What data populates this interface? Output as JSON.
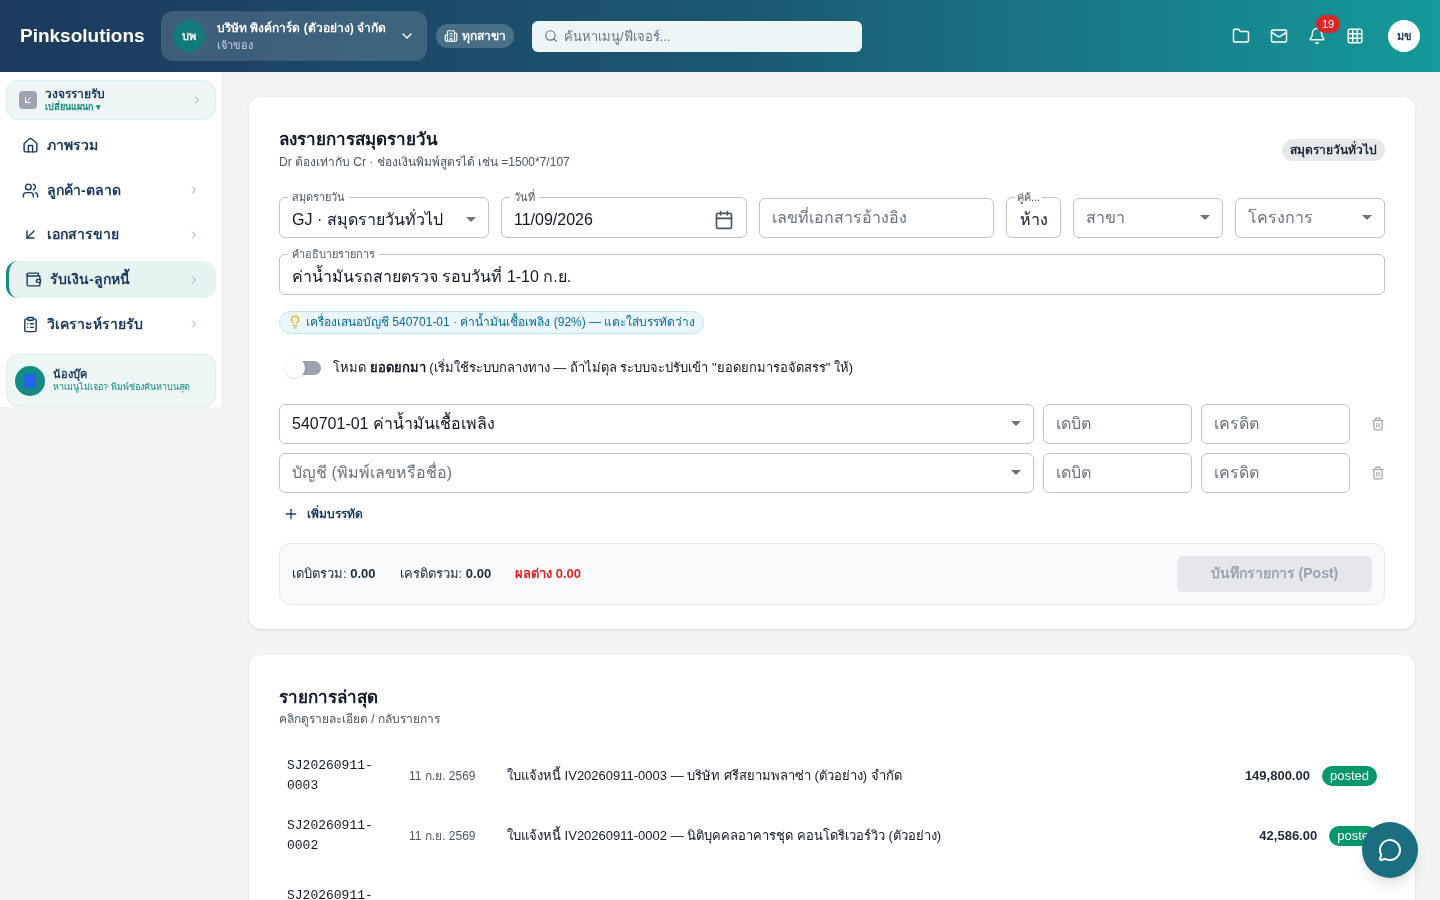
{
  "header": {
    "brand": "Pinksolutions",
    "org": {
      "initials": "บพ",
      "name": "บริษัท พิงค์การ์ด (ตัวอย่าง) จำกัด",
      "role": "เจ้าของ"
    },
    "branch": "ทุกสาขา",
    "search_placeholder": "ค้นหาเมนู/ฟีเจอร์...",
    "notifications": "19",
    "user_initials": "มข"
  },
  "sidebar": {
    "module": {
      "title": "วงจรรายรับ",
      "switch": "เปลี่ยนแผนก ▾"
    },
    "items": [
      {
        "label": "ภาพรวม",
        "kind": "link",
        "selected": false
      },
      {
        "label": "ลูกค้า-ตลาด",
        "kind": "group",
        "selected": false
      },
      {
        "label": "เอกสารขาย",
        "kind": "group",
        "selected": false
      },
      {
        "label": "รับเงิน-ลูกหนี้",
        "kind": "group",
        "selected": true
      },
      {
        "label": "วิเคราะห์รายรับ",
        "kind": "group",
        "selected": false
      }
    ],
    "assistant": {
      "name": "น้องบุ๊ค",
      "hint": "หาเมนูไม่เจอ? พิมพ์ช่องค้นหาบนสุด"
    }
  },
  "entry_form": {
    "title": "ลงรายการสมุดรายวัน",
    "subtitle": "Dr ต้องเท่ากับ Cr · ช่องเงินพิมพ์สูตรได้ เช่น =1500*7/107",
    "journal_badge": "สมุดรายวันทั่วไป",
    "journal": {
      "label": "สมุดรายวัน",
      "value": "GJ · สมุดรายวันทั่วไป"
    },
    "date": {
      "label": "วันที่",
      "value": "11/09/2026"
    },
    "reference": {
      "placeholder": "เลขที่เอกสารอ้างอิง"
    },
    "partner": {
      "label": "คู่ค้...",
      "value": "ห้าง"
    },
    "branch": {
      "placeholder": "สาขา"
    },
    "project": {
      "placeholder": "โครงการ"
    },
    "description": {
      "label": "คำอธิบายรายการ",
      "value": "ค่าน้ำมันรถสายตรวจ รอบวันที่ 1-10 ก.ย."
    },
    "suggestion": "เครื่องเสนอบัญชี 540701-01 · ค่าน้ำมันเชื้อเพลิง (92%) — แตะใส่บรรทัดว่าง",
    "opening_mode": {
      "on": false,
      "text": "โหมด **ยอดยกมา** (เริ่มใช้ระบบกลางทาง — ถ้าไม่ดุล ระบบจะปรับเข้า \"ยอดยกมารอจัดสรร\" ให้)"
    },
    "lines": [
      {
        "account": "540701-01 ค่าน้ำมันเชื้อเพลิง",
        "debit_placeholder": "เดบิต",
        "credit_placeholder": "เครดิต"
      },
      {
        "account_placeholder": "บัญชี (พิมพ์เลขหรือชื่อ)",
        "debit_placeholder": "เดบิต",
        "credit_placeholder": "เครดิต"
      }
    ],
    "add_line": "เพิ่มบรรทัด",
    "totals": {
      "debit_label": "เดบิตรวม:",
      "debit": "0.00",
      "credit_label": "เครดิตรวม:",
      "credit": "0.00",
      "difference": "ผลต่าง 0.00"
    },
    "post_button": {
      "label": "บันทึกรายการ (Post)",
      "disabled": true
    }
  },
  "recent": {
    "title": "รายการล่าสุด",
    "subtitle": "คลิกดูรายละเอียด / กลับรายการ",
    "rows": [
      {
        "code": "SJ20260911-0003",
        "date": "11 ก.ย. 2569",
        "description": "ใบแจ้งหนี้ IV20260911-0003 — บริษัท ศรีสยามพลาซ่า (ตัวอย่าง) จำกัด",
        "amount": "149,800.00",
        "status": "posted"
      },
      {
        "code": "SJ20260911-0002",
        "date": "11 ก.ย. 2569",
        "description": "ใบแจ้งหนี้ IV20260911-0002 — นิติบุคคลอาคารชุด คอนโดริเวอร์วิว (ตัวอย่าง)",
        "amount": "42,586.00",
        "status": "poste"
      },
      {
        "code": "SJ20260911-"
      }
    ]
  }
}
